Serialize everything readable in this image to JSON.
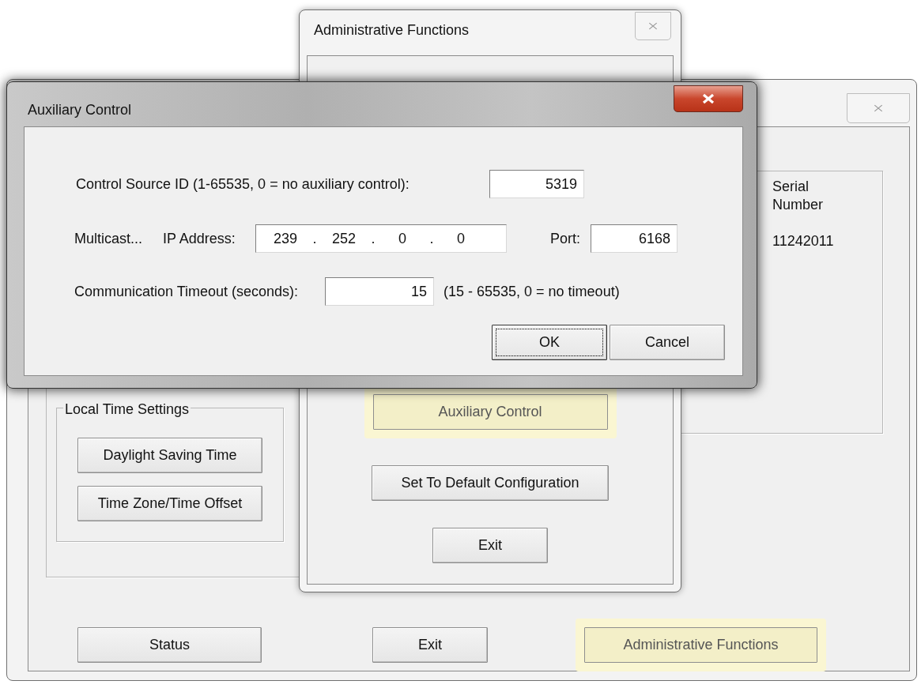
{
  "main_window": {
    "active": false,
    "serial_group": {
      "heading": "Serial Number",
      "value": "11242011"
    },
    "local_time_settings": {
      "title": "Local Time Settings",
      "buttons": [
        {
          "label": "Daylight Saving Time",
          "highlighted": false
        },
        {
          "label": "Time Zone/Time Offset",
          "highlighted": false
        }
      ]
    },
    "buttons": [
      {
        "label": "Status",
        "highlighted": false
      },
      {
        "label": "Exit",
        "highlighted": false
      },
      {
        "label": "Administrative Functions",
        "highlighted": true
      }
    ]
  },
  "admin_window": {
    "title": "Administrative Functions",
    "active": false,
    "buttons": [
      {
        "label": "Auxiliary Control",
        "highlighted": true
      },
      {
        "label": "Set To Default Configuration",
        "highlighted": false
      },
      {
        "label": "Exit",
        "highlighted": false
      }
    ]
  },
  "aux_window": {
    "title": "Auxiliary Control",
    "active": true,
    "control_source_id": {
      "label": "Control Source ID (1-65535, 0 = no auxiliary control):",
      "value": "5319"
    },
    "multicast": {
      "label": "Multicast...",
      "ip_label": "IP Address:",
      "octets": [
        "239",
        "252",
        "0",
        "0"
      ],
      "separator": ".",
      "port_label": "Port:",
      "port": "6168"
    },
    "timeout": {
      "label": "Communication Timeout (seconds):",
      "value": "15",
      "hint": "(15 - 65535, 0 = no timeout)"
    },
    "buttons": [
      {
        "label": "OK",
        "focused": true
      },
      {
        "label": "Cancel",
        "focused": false
      }
    ]
  }
}
